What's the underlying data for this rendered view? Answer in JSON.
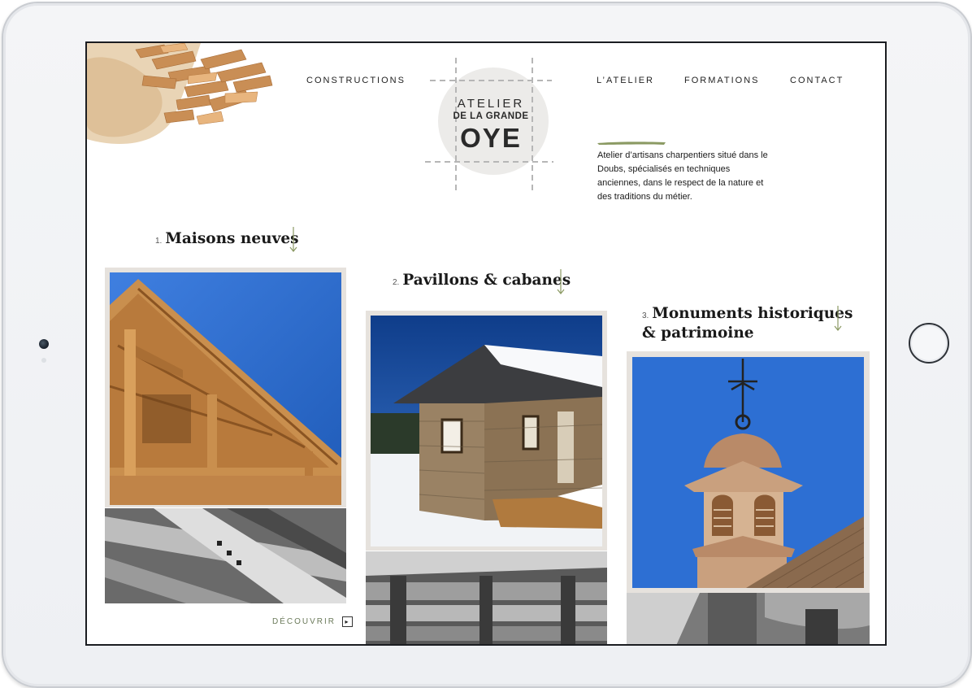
{
  "nav": {
    "constructions": "CONSTRUCTIONS",
    "atelier": "L’ATELIER",
    "formations": "FORMATIONS",
    "contact": "CONTACT"
  },
  "logo": {
    "line1": "ATELIER",
    "line2": "DE LA GRANDE",
    "line3": "OYE"
  },
  "intro": "Atelier d’artisans charpentiers situé dans le Doubs, spécialisés en techniques anciennes, dans le respect de la nature et des traditions du métier.",
  "sections": [
    {
      "number": "1.",
      "title": "Maisons neuves"
    },
    {
      "number": "2.",
      "title": "Pavillons & cabanes"
    },
    {
      "number": "3.",
      "title_line1": "Monuments historiques",
      "title_line2": "& patrimoine"
    }
  ],
  "discover": {
    "label": "DÉCOUVRIR",
    "icon": "arrow-right-box-icon"
  },
  "colors": {
    "accent_green": "#8b9a63",
    "frame": "#e6e2dd",
    "sky": "#2f6fd0"
  }
}
